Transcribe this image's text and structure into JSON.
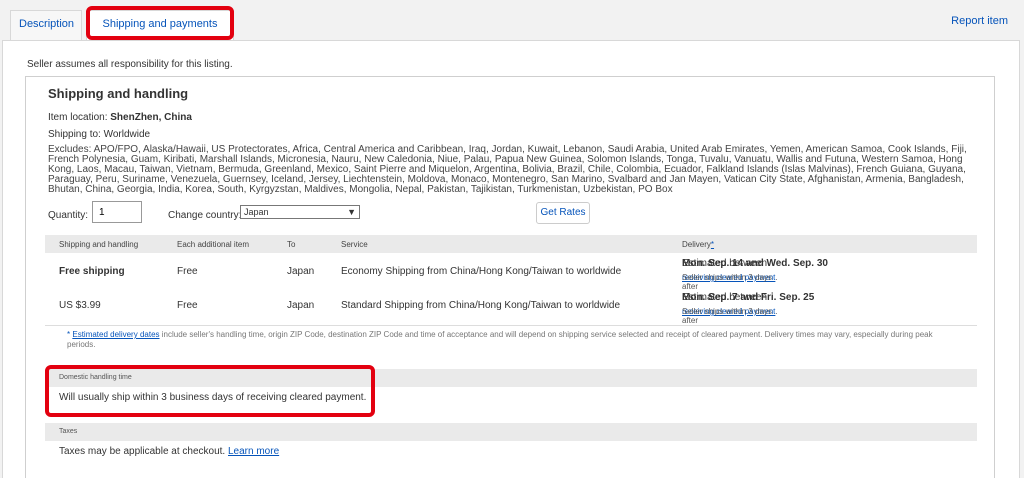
{
  "tabs": {
    "description": "Description",
    "shipping": "Shipping and payments",
    "report": "Report item"
  },
  "seller_note": "Seller assumes all responsibility for this listing.",
  "shipping": {
    "title": "Shipping and handling",
    "location_label": "Item location:",
    "location_value": "ShenZhen, China",
    "ship_to": "Shipping to: Worldwide",
    "excludes": "Excludes: APO/FPO, Alaska/Hawaii, US Protectorates, Africa, Central America and Caribbean, Iraq, Jordan, Kuwait, Lebanon, Saudi Arabia, United Arab Emirates, Yemen, American Samoa, Cook Islands, Fiji, French Polynesia, Guam, Kiribati, Marshall Islands, Micronesia, Nauru, New Caledonia, Niue, Palau, Papua New Guinea, Solomon Islands, Tonga, Tuvalu, Vanuatu, Wallis and Futuna, Western Samoa, Hong Kong, Laos, Macau, Taiwan, Vietnam, Bermuda, Greenland, Mexico, Saint Pierre and Miquelon, Argentina, Bolivia, Brazil, Chile, Colombia, Ecuador, Falkland Islands (Islas Malvinas), French Guiana, Guyana, Paraguay, Peru, Suriname, Venezuela, Guernsey, Iceland, Jersey, Liechtenstein, Moldova, Monaco, Montenegro, San Marino, Svalbard and Jan Mayen, Vatican City State, Afghanistan, Armenia, Bangladesh, Bhutan, China, Georgia, India, Korea, South, Kyrgyzstan, Maldives, Mongolia, Nepal, Pakistan, Tajikistan, Turkmenistan, Uzbekistan, PO Box",
    "quantity_label": "Quantity:",
    "quantity_value": "1",
    "country_label": "Change country:",
    "country_value": "Japan",
    "get_rates": "Get Rates"
  },
  "table": {
    "headers": [
      "Shipping and handling",
      "Each additional item",
      "To",
      "Service",
      "Delivery",
      "*"
    ],
    "rows": [
      {
        "cost": "Free shipping",
        "additional": "Free",
        "to": "Japan",
        "service": "Economy Shipping from China/Hong Kong/Taiwan to worldwide",
        "delivery_prefix": "Estimated between",
        "delivery_dates": "Mon. Sep. 14 and Wed. Sep. 30",
        "note_prefix": "Seller ships within 3 days after",
        "note_link": "receiving cleared payment",
        "note_suffix": "."
      },
      {
        "cost": "US $3.99",
        "additional": "Free",
        "to": "Japan",
        "service": "Standard Shipping from China/Hong Kong/Taiwan to worldwide",
        "delivery_prefix": "Estimated between",
        "delivery_dates": "Mon. Sep. 7 and Fri. Sep. 25",
        "note_prefix": "Seller ships within 3 days after",
        "note_link": "receiving cleared payment",
        "note_suffix": "."
      }
    ]
  },
  "footnote": {
    "star": "*",
    "link": "Estimated delivery dates",
    "text": "include seller's handling time, origin ZIP Code, destination ZIP Code and time of acceptance and will depend on shipping service selected and receipt of cleared payment. Delivery times may vary, especially during peak periods."
  },
  "domestic": {
    "head": "Domestic handling time",
    "body": "Will usually ship within 3 business days of receiving cleared payment."
  },
  "taxes": {
    "head": "Taxes",
    "body": "Taxes may be applicable at checkout.",
    "link": "Learn more"
  },
  "colors": {
    "link": "#0654ba",
    "highlight": "#e3000f",
    "header_bg": "#eaeaea"
  }
}
